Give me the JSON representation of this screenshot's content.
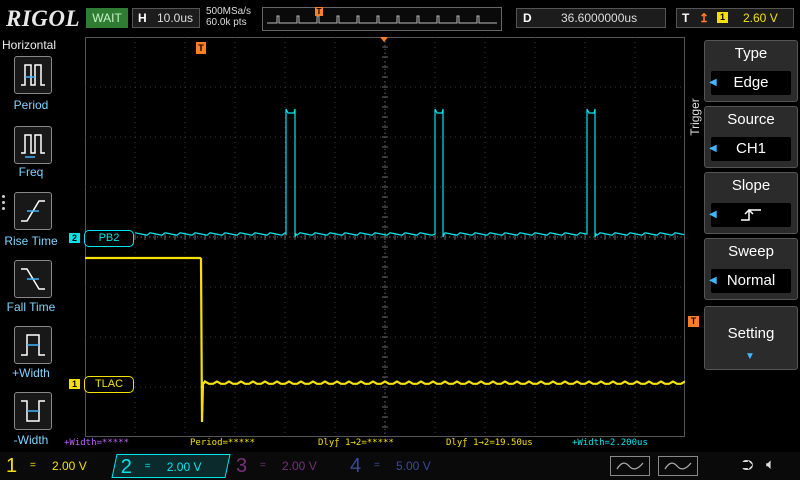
{
  "header": {
    "logo": "RIGOL",
    "status": "WAIT",
    "timebase_label": "H",
    "timebase_value": "10.0us",
    "sample_rate": "500MSa/s",
    "memory_depth": "60.0k pts",
    "memory_trigger_marker": "T",
    "delay_label": "D",
    "delay_value": "36.6000000us",
    "trigger_label": "T",
    "trigger_channel": "1",
    "trigger_level": "2.60 V"
  },
  "left_menu": {
    "title": "Horizontal",
    "items": [
      {
        "label": "Period"
      },
      {
        "label": "Freq"
      },
      {
        "label": "Rise Time"
      },
      {
        "label": "Fall Time"
      },
      {
        "label": "+Width"
      },
      {
        "label": "-Width"
      }
    ]
  },
  "right_menu": {
    "section_label": "Trigger",
    "items": [
      {
        "title": "Type",
        "value": "Edge"
      },
      {
        "title": "Source",
        "value": "CH1"
      },
      {
        "title": "Slope",
        "value": "rising-edge"
      },
      {
        "title": "Sweep",
        "value": "Normal"
      },
      {
        "title": "Setting",
        "value": ""
      }
    ]
  },
  "traces": {
    "ch1_label": "TLAC",
    "ch1_marker": "1",
    "ch2_label": "PB2",
    "ch2_marker": "2",
    "trigger_level_marker": "T",
    "trigger_pos_marker": "T"
  },
  "measurements": {
    "m1": "+Width=*****",
    "m2": "Period=*****",
    "m3": "Dlyƒ 1→2=*****",
    "m4": "Dlyƒ 1→2=19.50us",
    "m5": "+Width=2.200us"
  },
  "channels": [
    {
      "num": "1",
      "coupling": "=",
      "scale": "2.00 V",
      "color": "#f5e100"
    },
    {
      "num": "2",
      "coupling": "=",
      "scale": "2.00 V",
      "color": "#00e5ee"
    },
    {
      "num": "3",
      "coupling": "=",
      "scale": "2.00 V",
      "color": "#7a2f7a"
    },
    {
      "num": "4",
      "coupling": "=",
      "scale": "5.00 V",
      "color": "#3c4a96"
    }
  ],
  "colors": {
    "ch1": "#f5e100",
    "ch2": "#00e5ee",
    "accent": "#ff7f27",
    "menu_arrow": "#3fb7ff"
  }
}
